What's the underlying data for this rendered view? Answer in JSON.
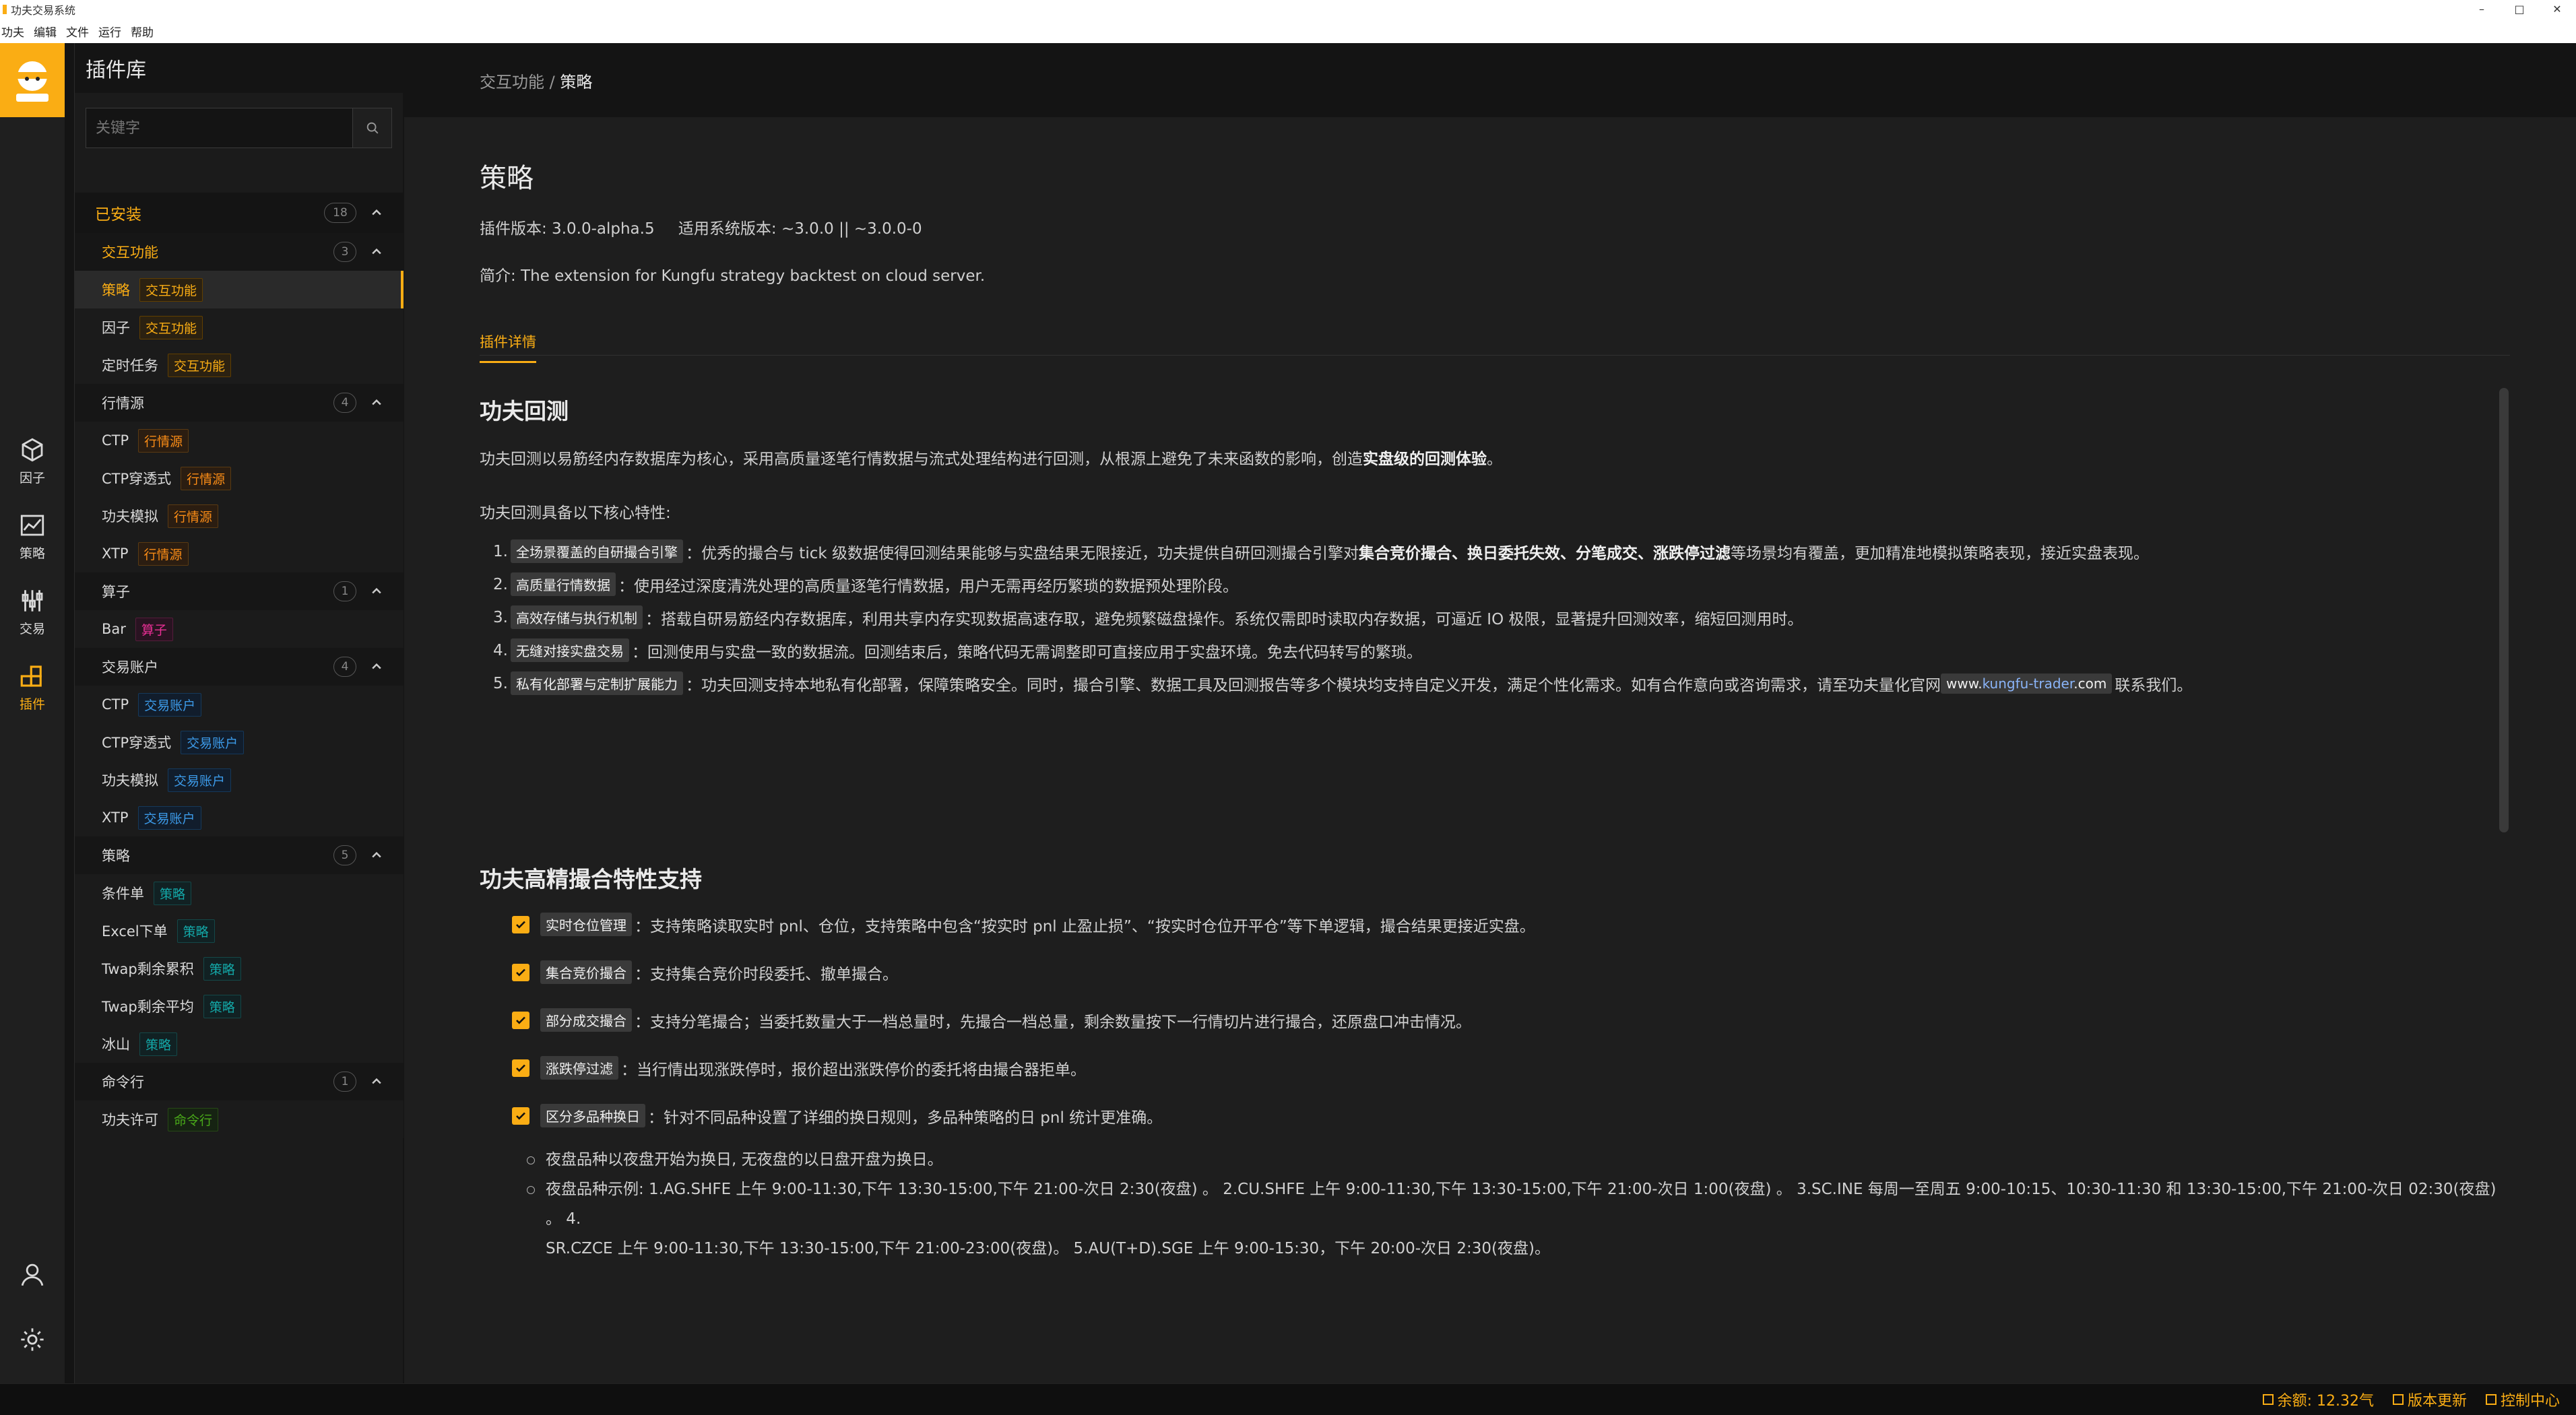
{
  "window": {
    "title": "功夫交易系统",
    "minimize": "–",
    "maximize": "□",
    "close": "✕"
  },
  "menu": [
    "功夫",
    "编辑",
    "文件",
    "运行",
    "帮助"
  ],
  "activity": [
    {
      "label": "因子",
      "icon": "cube-icon"
    },
    {
      "label": "策略",
      "icon": "line-chart-icon"
    },
    {
      "label": "交易",
      "icon": "sliders-icon"
    },
    {
      "label": "插件",
      "icon": "plugins-icon"
    }
  ],
  "sidebar": {
    "title": "插件库",
    "search_placeholder": "关键字",
    "installed_label": "已安装",
    "installed_count": "18",
    "groups": [
      {
        "name": "交互功能",
        "count": "3",
        "items": [
          {
            "name": "策略",
            "tag": "交互功能"
          },
          {
            "name": "因子",
            "tag": "交互功能"
          },
          {
            "name": "定时任务",
            "tag": "交互功能"
          }
        ]
      },
      {
        "name": "行情源",
        "count": "4",
        "items": [
          {
            "name": "CTP",
            "tag": "行情源"
          },
          {
            "name": "CTP穿透式",
            "tag": "行情源"
          },
          {
            "name": "功夫模拟",
            "tag": "行情源"
          },
          {
            "name": "XTP",
            "tag": "行情源"
          }
        ]
      },
      {
        "name": "算子",
        "count": "1",
        "items": [
          {
            "name": "Bar",
            "tag": "算子"
          }
        ]
      },
      {
        "name": "交易账户",
        "count": "4",
        "items": [
          {
            "name": "CTP",
            "tag": "交易账户"
          },
          {
            "name": "CTP穿透式",
            "tag": "交易账户"
          },
          {
            "name": "功夫模拟",
            "tag": "交易账户"
          },
          {
            "name": "XTP",
            "tag": "交易账户"
          }
        ]
      },
      {
        "name": "策略",
        "count": "5",
        "items": [
          {
            "name": "条件单",
            "tag": "策略"
          },
          {
            "name": "Excel下单",
            "tag": "策略"
          },
          {
            "name": "Twap剩余累积",
            "tag": "策略"
          },
          {
            "name": "Twap剩余平均",
            "tag": "策略"
          },
          {
            "name": "冰山",
            "tag": "策略"
          }
        ]
      },
      {
        "name": "命令行",
        "count": "1",
        "items": [
          {
            "name": "功夫许可",
            "tag": "命令行"
          }
        ]
      }
    ]
  },
  "breadcrumb": {
    "parent": "交互功能 /",
    "current": "策略"
  },
  "plugin": {
    "title": "策略",
    "version": "插件版本: 3.0.0-alpha.5",
    "compat": "适用系统版本: ~3.0.0 || ~3.0.0-0",
    "intro": "简介: The extension for Kungfu strategy backtest on cloud server.",
    "tab": "插件详情"
  },
  "doc": {
    "h_backtest": "功夫回测",
    "p1_a": "功夫回测以易筋经内存数据库为核心，采用高质量逐笔行情数据与流式处理结构进行回测，从根源上避免了未来函数的影响，创造",
    "p1_b": "实盘级的回测体验",
    "p1_c": "。",
    "p2": "功夫回测具备以下核心特性:",
    "features": [
      {
        "n": "1.",
        "tag": "全场景覆盖的自研撮合引擎",
        "text": "：优秀的撮合与 tick 级数据使得回测结果能够与实盘结果无限接近，功夫提供自研回测撮合引擎对 ",
        "bold": "集合竞价撮合、换日委托失效、分笔成交、涨跌停过滤",
        "tail": "等场景均有覆盖，更加精准地模拟策略表现，接近实盘表现。"
      },
      {
        "n": "2.",
        "tag": "高质量行情数据",
        "text": "：使用经过深度清洗处理的高质量逐笔行情数据，用户无需再经历繁琐的数据预处理阶段。",
        "bold": "",
        "tail": ""
      },
      {
        "n": "3.",
        "tag": "高效存储与执行机制",
        "text": "：搭载自研易筋经内存数据库，利用共享内存实现数据高速存取，避免频繁磁盘操作。系统仅需即时读取内存数据，可逼近 IO 极限，显著提升回测效率，缩短回测用时。",
        "bold": "",
        "tail": ""
      },
      {
        "n": "4.",
        "tag": "无缝对接实盘交易",
        "text": "：回测使用与实盘一致的数据流。回测结束后，策略代码无需调整即可直接应用于实盘环境。免去代码转写的繁琐。",
        "bold": "",
        "tail": ""
      },
      {
        "n": "5.",
        "tag": "私有化部署与定制扩展能力",
        "text": "：功夫回测支持本地私有化部署，保障策略安全。同时，撮合引擎、数据工具及回测报告等多个模块均支持自定义开发，满足个性化需求。如有合作意向或咨询需求，请至功夫量化官网 ",
        "link_pre": "www.",
        "link": "kungfu-trader",
        "link_post": ".com",
        "after": " 联系我们。"
      }
    ],
    "h_match": "功夫高精撮合特性支持",
    "checks": [
      {
        "tag": "实时仓位管理",
        "text": "：支持策略读取实时 pnl、仓位，支持策略中包含“按实时 pnl 止盈止损”、“按实时仓位开平仓”等下单逻辑，撮合结果更接近实盘。"
      },
      {
        "tag": "集合竞价撮合",
        "text": "：支持集合竞价时段委托、撤单撮合。"
      },
      {
        "tag": "部分成交撮合",
        "text": "：支持分笔撮合；当委托数量大于一档总量时，先撮合一档总量，剩余数量按下一行情切片进行撮合，还原盘口冲击情况。"
      },
      {
        "tag": "涨跌停过滤",
        "text": "：当行情出现涨跌停时，报价超出涨跌停价的委托将由撮合器拒单。"
      },
      {
        "tag": "区分多品种换日",
        "text": "：针对不同品种设置了详细的换日规则，多品种策略的日 pnl 统计更准确。"
      }
    ],
    "sub1": "夜盘品种以夜盘开始为换日, 无夜盘的以日盘开盘为换日。",
    "sub2_l1": "夜盘品种示例:  1.AG.SHFE 上午 9:00-11:30,下午 13:30-15:00,下午 21:00-次日 2:30(夜盘) 。 2.CU.SHFE 上午 9:00-11:30,下午 13:30-15:00,下午 21:00-次日 1:00(夜盘) 。 3.SC.INE 每周一至周五 9:00-10:15、10:30-11:30 和 13:30-15:00,下午 21:00-次日 02:30(夜盘) 。 4.",
    "sub2_l2": "SR.CZCE 上午 9:00-11:30,下午 13:30-15:00,下午 21:00-23:00(夜盘)。 5.AU(T+D).SGE 上午 9:00-15:30，下午 20:00-次日 2:30(夜盘)。"
  },
  "status": {
    "balance": "余额: 12.32气",
    "update": "版本更新",
    "control": "控制中心"
  },
  "colors": {
    "accent": "#faad14",
    "bg": "#1e1e1e",
    "sidebar": "#1b1b1b"
  }
}
